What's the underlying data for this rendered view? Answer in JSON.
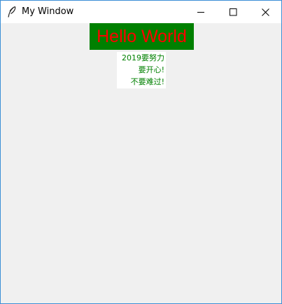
{
  "window": {
    "title": "My Window",
    "title_icon": "feather-icon",
    "controls": {
      "minimize_icon": "minimize-icon",
      "maximize_icon": "maximize-icon",
      "close_icon": "close-icon"
    }
  },
  "content": {
    "hello_label": {
      "text": "Hello World",
      "background": "#008000",
      "foreground": "#ff0000"
    },
    "message_label": {
      "lines": [
        "2019要努力",
        "要开心!",
        "不要难过!"
      ],
      "background": "#ffffff",
      "foreground": "#008000"
    }
  },
  "colors": {
    "window_border": "#3c8fd6",
    "client_background": "#f0f0f0",
    "titlebar_background": "#ffffff"
  }
}
